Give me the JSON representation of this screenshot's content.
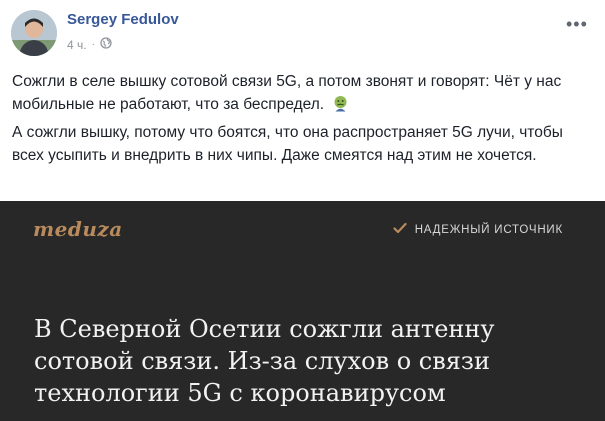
{
  "post": {
    "author": "Sergey Fedulov",
    "time": "4 ч.",
    "dot": "·",
    "paragraph1": "Сожгли в селе вышку сотовой связи 5G, а потом звонят и говорят: Чёт у нас мобильные не работают, что за беспредел.",
    "paragraph2": "А сожгли вышку, потому что боятся, что она распространяет 5G лучи, чтобы всех усыпить и внедрить в них чипы. Даже смеятся над этим не хочется."
  },
  "card": {
    "logo": "meduza",
    "badge": "НАДЕЖНЫЙ ИСТОЧНИК",
    "headline": "В Северной Осетии сожгли антенну сотовой связи. Из-за слухов о связи технологии 5G с коронавирусом"
  },
  "colors": {
    "author": "#385898",
    "card_bg": "#282828",
    "logo": "#b88a5c"
  },
  "icons": [
    "more-options-icon",
    "globe-icon",
    "nauseated-face-emoji-icon",
    "checkmark-icon"
  ]
}
